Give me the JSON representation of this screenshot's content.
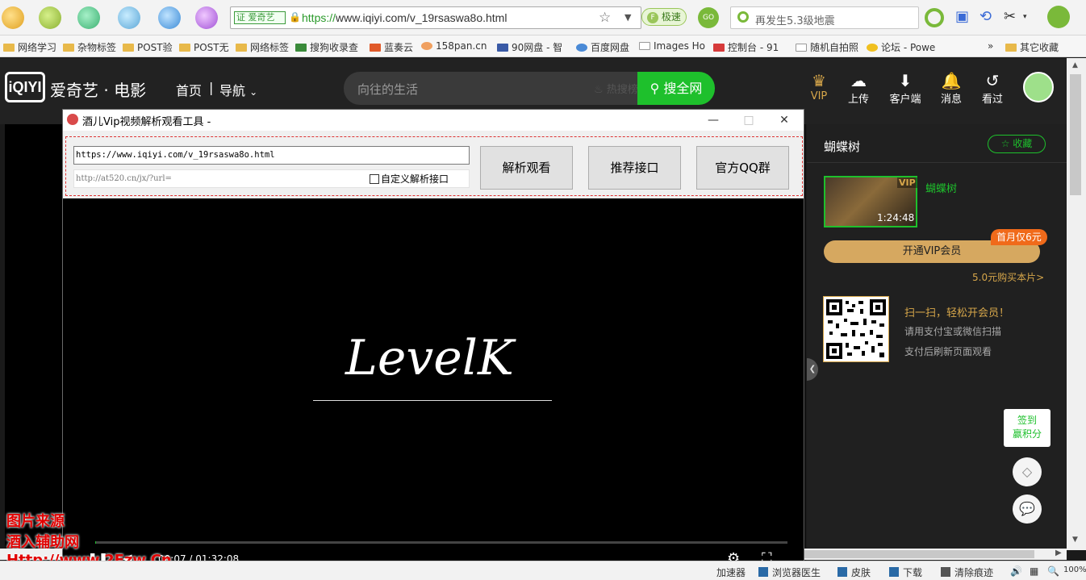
{
  "browser": {
    "url_cert": "爱奇艺",
    "url_cert_prefix": "证",
    "url_scheme": "https://",
    "url_rest": "www.iqiyi.com/v_19rsaswa8o.html",
    "speed_label": "极速",
    "speed_prefix": "F",
    "go_label": "GO",
    "search_text": "再发生5.3级地震"
  },
  "bookmarks": [
    {
      "label": "网络学习"
    },
    {
      "label": "杂物标签"
    },
    {
      "label": "POST验"
    },
    {
      "label": "POST无"
    },
    {
      "label": "网络标签"
    },
    {
      "label": "搜狗收录查"
    },
    {
      "label": "蓝奏云"
    },
    {
      "label": "158pan.cn"
    },
    {
      "label": "90网盘 - 智"
    },
    {
      "label": "百度网盘"
    },
    {
      "label": "Images Ho"
    },
    {
      "label": "控制台 - 91"
    },
    {
      "label": "随机自拍照"
    },
    {
      "label": "论坛 - Powe"
    },
    {
      "label": "其它收藏"
    }
  ],
  "bookmarks_more": "»",
  "iqiyi": {
    "logo": "iQIYI",
    "brand": "爱奇艺 · 电影",
    "nav_home": "首页",
    "nav_sep": "|",
    "nav_guide": "导航",
    "search_placeholder": "向往的生活",
    "hot_label": "热搜榜",
    "search_button": "搜全网",
    "header_icons": [
      {
        "label": "VIP",
        "icon": "crown-icon"
      },
      {
        "label": "上传",
        "icon": "upload-cloud-icon"
      },
      {
        "label": "客户端",
        "icon": "download-icon"
      },
      {
        "label": "消息",
        "icon": "bell-icon"
      },
      {
        "label": "看过",
        "icon": "history-icon"
      }
    ]
  },
  "tool_window": {
    "title": "酒儿Vip视频解析观看工具 -",
    "minimize": "—",
    "maximize": "□",
    "close": "✕",
    "url_value": "https://www.iqiyi.com/v_19rsaswa8o.html",
    "api_value": "http://at520.cn/jx/?url=",
    "custom_label": "自定义解析接口",
    "btn_parse": "解析观看",
    "btn_recommend": "推荐接口",
    "btn_qq": "官方QQ群"
  },
  "player": {
    "overlay_text": "LevelK",
    "time_current": "00:07",
    "time_total": "01:32:08",
    "progress": 0.0013
  },
  "right_panel": {
    "title": "蝴蝶树",
    "collect": "收藏",
    "thumb_vip": "VIP",
    "thumb_duration": "1:24:48",
    "thumb_title": "蝴蝶树",
    "vip_button": "开通VIP会员",
    "badge": "首月仅6元",
    "buy": "5.0元购买本片>",
    "qr_title": "扫一扫，轻松开会员！",
    "qr_line1": "请用支付宝或微信扫描",
    "qr_line2": "支付后刷新页面观看",
    "sign_line1": "签到",
    "sign_line2": "赢积分"
  },
  "watermark": {
    "line1": "图片来源",
    "line2": "酒入辅助网",
    "line3": "Http://www.2Fzw.Cn"
  },
  "statusbar": {
    "accelerator": "加速器",
    "doctor": "浏览器医生",
    "skin": "皮肤",
    "download": "下载",
    "clear": "清除痕迹",
    "zoom": "100%"
  }
}
